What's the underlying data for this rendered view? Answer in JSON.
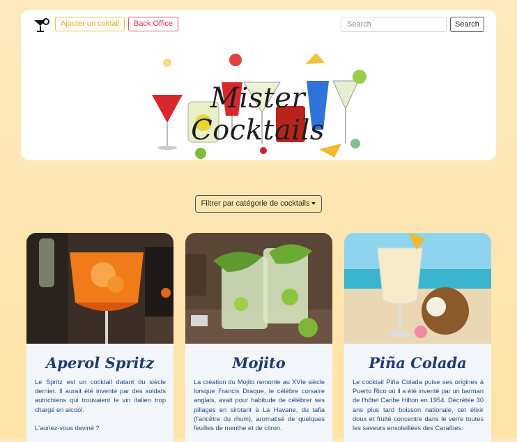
{
  "nav": {
    "add_label": "Ajouter un coktail",
    "back_label": "Back Office",
    "search_placeholder": "Search",
    "search_button": "Search"
  },
  "banner": {
    "title": "Mister Cocktails"
  },
  "filter": {
    "label": "Filtrer par catégorie de cocktails"
  },
  "cards": [
    {
      "title": "Aperol Spritz",
      "text": "Le Spritz est un cocktail datant du siècle dernier. Il aurait été inventé par des soldats autrichiens qui trouvaient le vin italien trop chargé en alcool.\n\nL'auriez-vous deviné ?"
    },
    {
      "title": "Mojito",
      "text": "La création du Mojito remonte au XVIe siècle lorsque Francis Draque, le célèbre corsaire anglais, avait pour habitude de célébrer ses pillages en sirotant à La Havane, du tafia (l'ancêtre du rhum), aromatisé de quelques feuilles de menthe et de citron."
    },
    {
      "title": "Piña Colada",
      "text": "Le cocktail Piña Colada puise ses origines à Puerto Rico où il a été inventé par un barman de l'hôtel Caribe Hilton en 1954. Décrétée 30 ans plus tard boisson nationale, cet élixir doux et fruité concentre dans le verre toutes les saveurs ensoleillées des Caraïbes."
    }
  ]
}
